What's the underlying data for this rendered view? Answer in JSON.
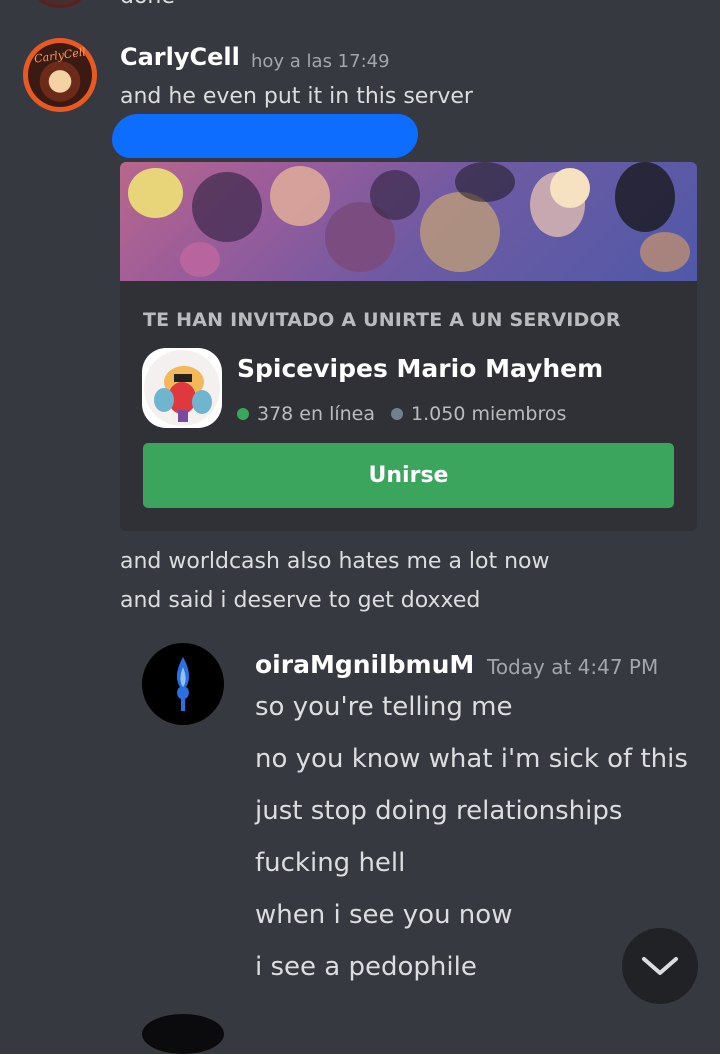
{
  "previous_message": {
    "text": "done"
  },
  "message1": {
    "author": "CarlyCell",
    "avatar_text": "CarlyCell",
    "timestamp": "hoy a las 17:49",
    "lines": [
      "and he even put it in this server"
    ],
    "redacted_color": "#0d6dff"
  },
  "invite": {
    "heading": "TE HAN INVITADO A UNIRTE A UN SERVIDOR",
    "server_name": "Spicevipes Mario Mayhem",
    "online": "378 en línea",
    "members": "1.050 miembros",
    "join_label": "Unirse",
    "online_color": "#3ba55d",
    "members_color": "#747f8d",
    "button_color": "#3ba55d"
  },
  "message1_more": {
    "lines": [
      "and worldcash also hates me a lot now",
      "and said i deserve to get doxxed"
    ]
  },
  "quoted": {
    "author": "oiraMgnilbmuM",
    "timestamp": "Today at 4:47 PM",
    "lines": [
      "so you're telling me",
      "no you know what i'm sick of this",
      "just stop doing relationships",
      "fucking hell",
      "when i see you now",
      "i see a pedophile"
    ]
  },
  "icons": {
    "scroll": "chevron-down-icon",
    "avatar1": "avatar-icon",
    "avatar2": "flame-avatar-icon"
  }
}
